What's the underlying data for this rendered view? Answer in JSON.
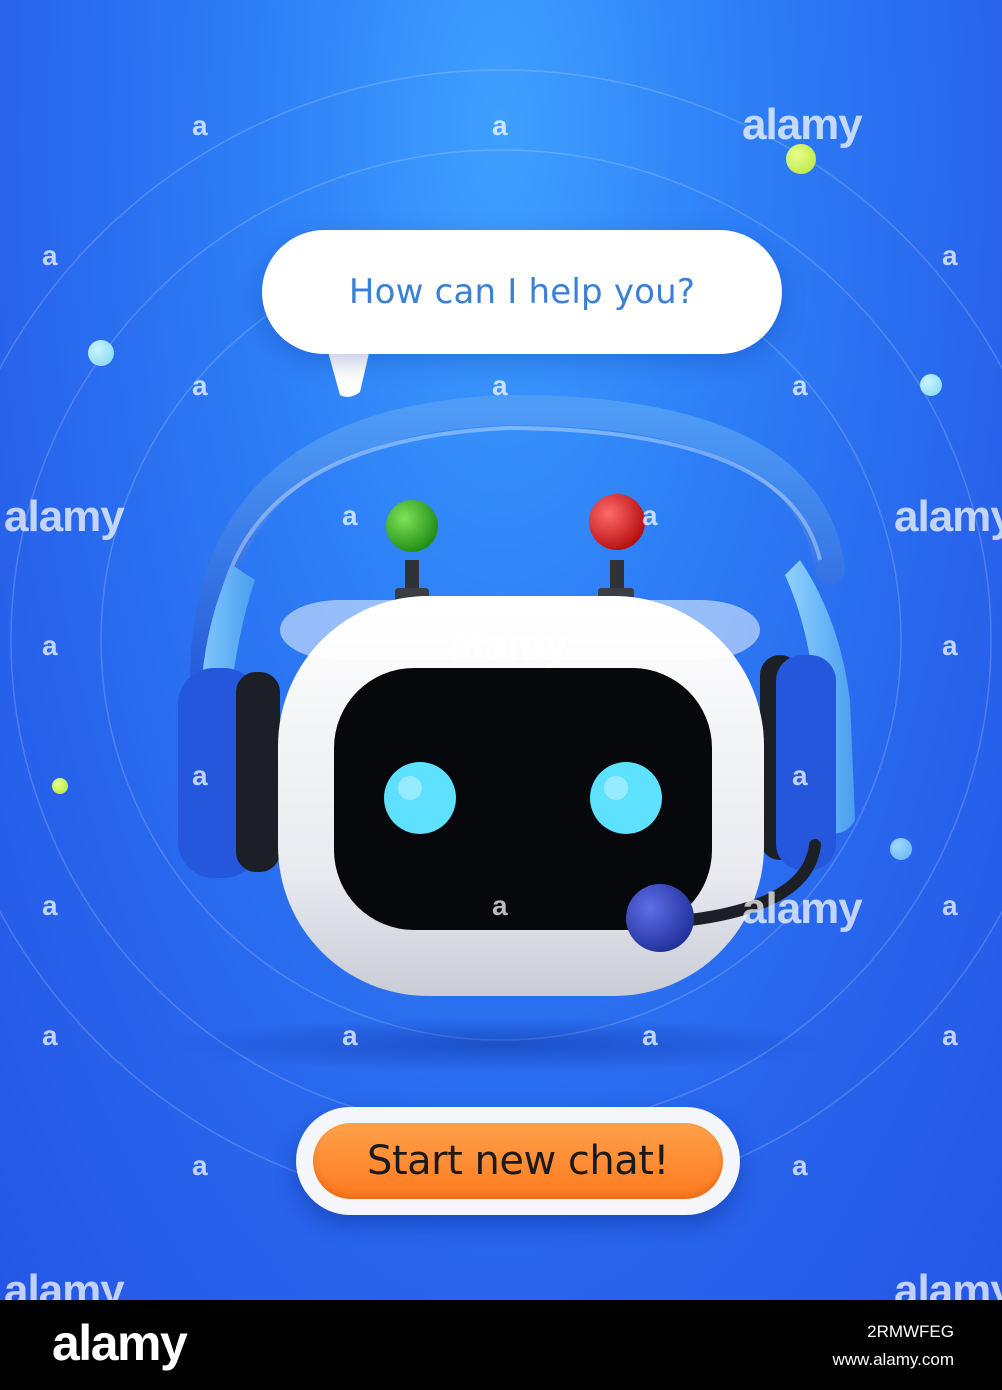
{
  "bubble": {
    "text": "How can I help you?"
  },
  "cta": {
    "label": "Start new chat!"
  },
  "watermark": {
    "brand": "alamy",
    "small_mark": "a"
  },
  "footer": {
    "logo": "alamy",
    "image_id": "2RMWFEG",
    "url": "www.alamy.com"
  },
  "colors": {
    "background": "#2d7ef6",
    "bubble_text": "#3a7fd8",
    "cta": "#ff7a1e",
    "antenna_left": "#2fae1e",
    "antenna_right": "#e01818",
    "eyes": "#5ee0ff",
    "headset": "#2a6fe0"
  },
  "icons": [
    "speech-bubble-icon",
    "robot-icon",
    "headset-icon",
    "microphone-icon"
  ]
}
